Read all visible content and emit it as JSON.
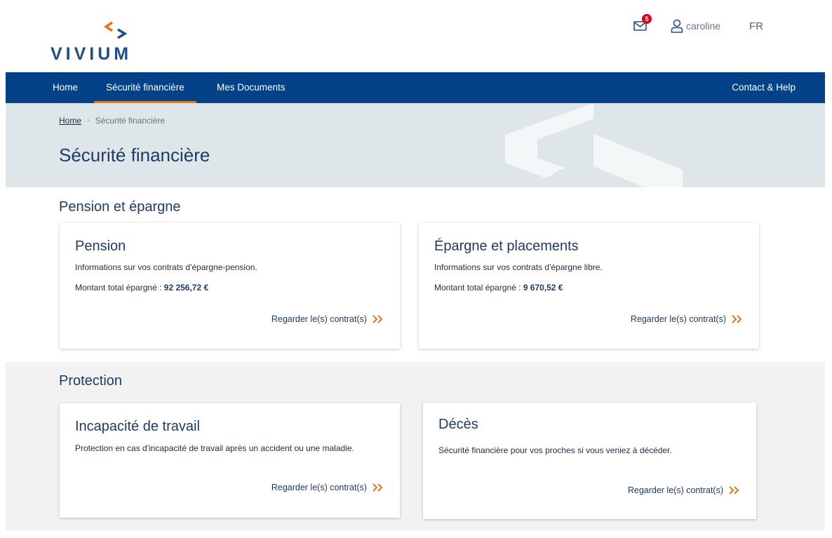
{
  "brand": {
    "name": "VIVIUM",
    "accent_orange": "#e8731e",
    "brand_blue": "#034189"
  },
  "header": {
    "notifications_count": "5",
    "username": "caroline",
    "language": "FR"
  },
  "nav": {
    "items": [
      {
        "label": "Home"
      },
      {
        "label": "Sécurité financière"
      },
      {
        "label": "Mes Documents"
      }
    ],
    "help_label": "Contact & Help"
  },
  "breadcrumb": {
    "home": "Home",
    "current": "Sécurité financière"
  },
  "page": {
    "title": "Sécurité financière"
  },
  "sections": {
    "pension": {
      "title": "Pension et épargne",
      "cards": [
        {
          "title": "Pension",
          "description": "Informations sur vos contrats d'épargne-pension.",
          "amount_label": "Montant total épargné :",
          "amount_value": "92 256,72 €",
          "link": "Regarder le(s) contrat(s)"
        },
        {
          "title": "Épargne et placements",
          "description": "Informations sur vos contrats d'épargne libre.",
          "amount_label": "Montant total épargné :",
          "amount_value": "9 670,52 €",
          "link": "Regarder le(s) contrat(s)"
        }
      ]
    },
    "protection": {
      "title": "Protection",
      "cards": [
        {
          "title": "Incapacité de travail",
          "description": "Protection en cas d'incapacité de travail après un accident ou une maladie.",
          "link": "Regarder le(s) contrat(s)"
        },
        {
          "title": "Décès",
          "description": "Sécurité financière pour vos proches si vous veniez à décéder.",
          "link": "Regarder le(s) contrat(s)"
        }
      ]
    }
  }
}
